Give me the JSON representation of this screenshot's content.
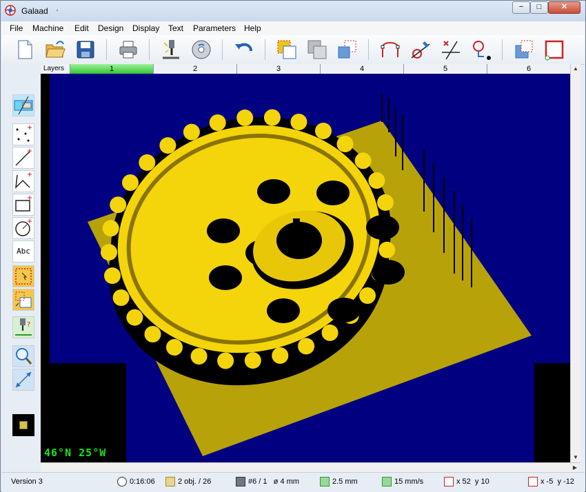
{
  "window": {
    "title": "Galaad",
    "title_suffix": "·",
    "controls": {
      "minimize": "−",
      "maximize": "□",
      "close": "✕"
    }
  },
  "menu": [
    "File",
    "Machine",
    "Edit",
    "Design",
    "Display",
    "Text",
    "Parameters",
    "Help"
  ],
  "toolbar": [
    {
      "name": "new-file-icon"
    },
    {
      "name": "open-folder-icon"
    },
    {
      "name": "save-disk-icon"
    },
    {
      "name": "print-icon"
    },
    {
      "name": "machine-tool-icon"
    },
    {
      "name": "simulation-disk-icon"
    },
    {
      "name": "undo-icon"
    },
    {
      "name": "copy-objects-icon"
    },
    {
      "name": "group-objects-icon"
    },
    {
      "name": "array-objects-icon"
    },
    {
      "name": "node-edit-icon"
    },
    {
      "name": "tangent-line-icon"
    },
    {
      "name": "cut-line-icon"
    },
    {
      "name": "point-select-icon"
    },
    {
      "name": "rotate-objects-icon"
    },
    {
      "name": "frame-icon"
    }
  ],
  "layers": {
    "label": "Layers",
    "tabs": [
      "1",
      "2",
      "3",
      "4",
      "5",
      "6"
    ],
    "active_index": 0
  },
  "left_tools": [
    {
      "name": "machine-stop-icon"
    },
    {
      "name": "points-tool-icon"
    },
    {
      "name": "line-tool-icon"
    },
    {
      "name": "polyline-tool-icon"
    },
    {
      "name": "rectangle-tool-icon"
    },
    {
      "name": "circle-tool-icon"
    },
    {
      "name": "text-tool-icon",
      "label": "Abc"
    },
    {
      "name": "select-area-icon"
    },
    {
      "name": "move-resize-icon"
    },
    {
      "name": "tool-path-icon"
    },
    {
      "name": "zoom-icon"
    },
    {
      "name": "measure-icon"
    },
    {
      "name": "color-swatch-icon"
    }
  ],
  "view": {
    "orientation": "46°N 25°W",
    "background": "#000080",
    "part_color": "#f4d40b",
    "plate_color": "#b8a20a"
  },
  "status": {
    "version": "Version 3",
    "time": "0:16:06",
    "objects": "2 obj. / 26",
    "tool": "#6 / 1   ø 4 mm",
    "depth": "2.5 mm",
    "speed": "15 mm/s",
    "pos_x": "x 52",
    "pos_y": "y 10",
    "rel_x": "x -5",
    "rel_y": "y -12"
  }
}
